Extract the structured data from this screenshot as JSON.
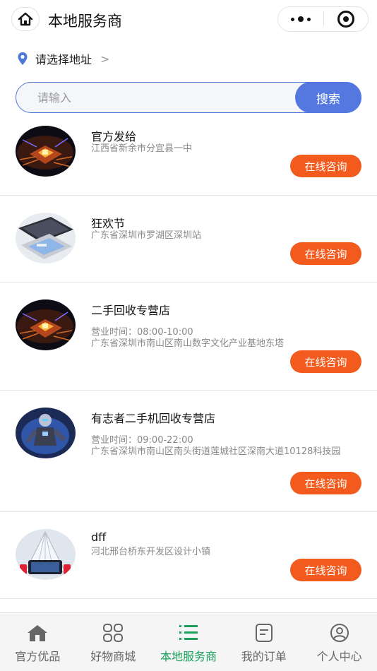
{
  "header": {
    "title": "本地服务商",
    "home_icon": "home-icon",
    "more_icon": "more-dots-icon",
    "close_icon": "target-close-icon"
  },
  "address": {
    "icon": "location-pin-icon",
    "label": "请选择地址",
    "chevron": ">",
    "accent_color": "#4e79d9"
  },
  "search": {
    "placeholder": "请输入",
    "button_label": "搜索",
    "button_color": "#5478e0"
  },
  "stores": [
    {
      "name": "官方发给",
      "hours": "",
      "address": "江西省新余市分宜县一中",
      "button": "在线咨询",
      "avatar": "chip-image"
    },
    {
      "name": "狂欢节",
      "hours": "",
      "address": "广东省深圳市罗湖区深圳站",
      "button": "在线咨询",
      "avatar": "laptop-image"
    },
    {
      "name": "二手回收专营店",
      "hours": "营业时间：08:00-10:00",
      "address": "广东省深圳市南山区南山数字文化产业基地东塔",
      "button": "在线咨询",
      "avatar": "chip-image"
    },
    {
      "name": "有志者二手机回收专营店",
      "hours": "营业时间：09:00-22:00",
      "address": "广东省深圳市南山区南头街道莲城社区深南大道10128科技园",
      "button": "在线咨询",
      "avatar": "hero-image"
    },
    {
      "name": "dff",
      "hours": "",
      "address": "河北邢台桥东开发区设计小镇",
      "button": "在线咨询",
      "avatar": "phone-image"
    }
  ],
  "tabs": [
    {
      "label": "官方优品",
      "icon": "home-icon",
      "active": false
    },
    {
      "label": "好物商城",
      "icon": "grid-icon",
      "active": false
    },
    {
      "label": "本地服务商",
      "icon": "list-icon",
      "active": true
    },
    {
      "label": "我的订单",
      "icon": "order-icon",
      "active": false
    },
    {
      "label": "个人中心",
      "icon": "user-icon",
      "active": false
    }
  ],
  "colors": {
    "consult_button": "#f35a1e",
    "tab_active": "#1aa05a",
    "tab_inactive": "#666666"
  }
}
